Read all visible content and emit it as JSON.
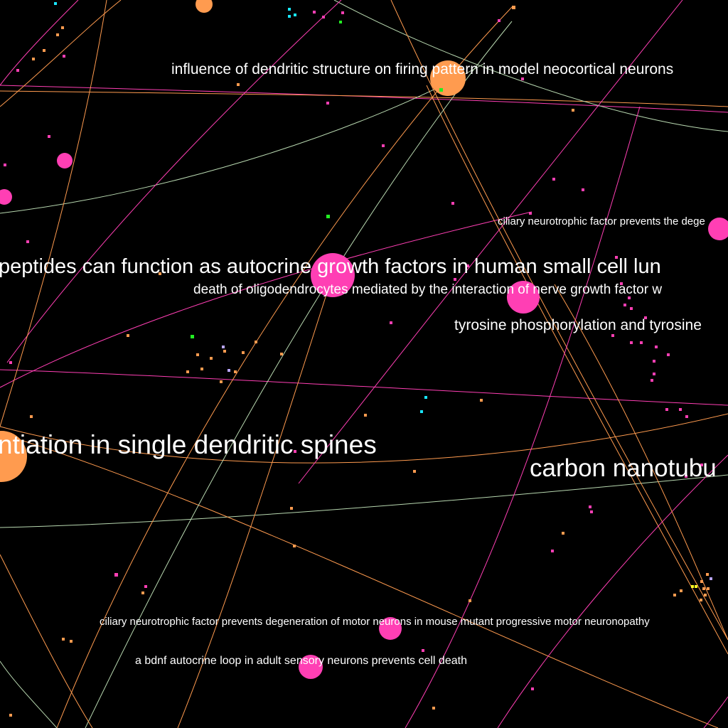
{
  "colors": {
    "background": "#000000",
    "label": "#ffffff",
    "pink": "#ff3fb4",
    "orange": "#ff9b4f",
    "sage": "#b8d8b0",
    "cyan": "#19e6ff",
    "green": "#22ee22",
    "lavender": "#b9a6ff",
    "yellow": "#ffff22"
  },
  "labels": {
    "influence": "influence of dendritic structure on firing pattern in model neocortical neurons",
    "cntf_prevents_clipped": "ciliary neurotrophic factor prevents the dege",
    "peptides": "peptides can function as autocrine growth factors in human small cell lun",
    "oligodendrocytes": "death of oligodendrocytes mediated by the interaction of nerve growth factor w",
    "tyrosine": "tyrosine phosphorylation and tyrosine",
    "spines": "ntiation in single dendritic spines",
    "carbon": "carbon nanotubu",
    "cntf_motor": "ciliary neurotrophic factor prevents degeneration of motor neurons in mouse mutant progressive motor neuronopathy",
    "bdnf": "a bdnf autocrine loop in adult sensory neurons prevents cell death"
  }
}
